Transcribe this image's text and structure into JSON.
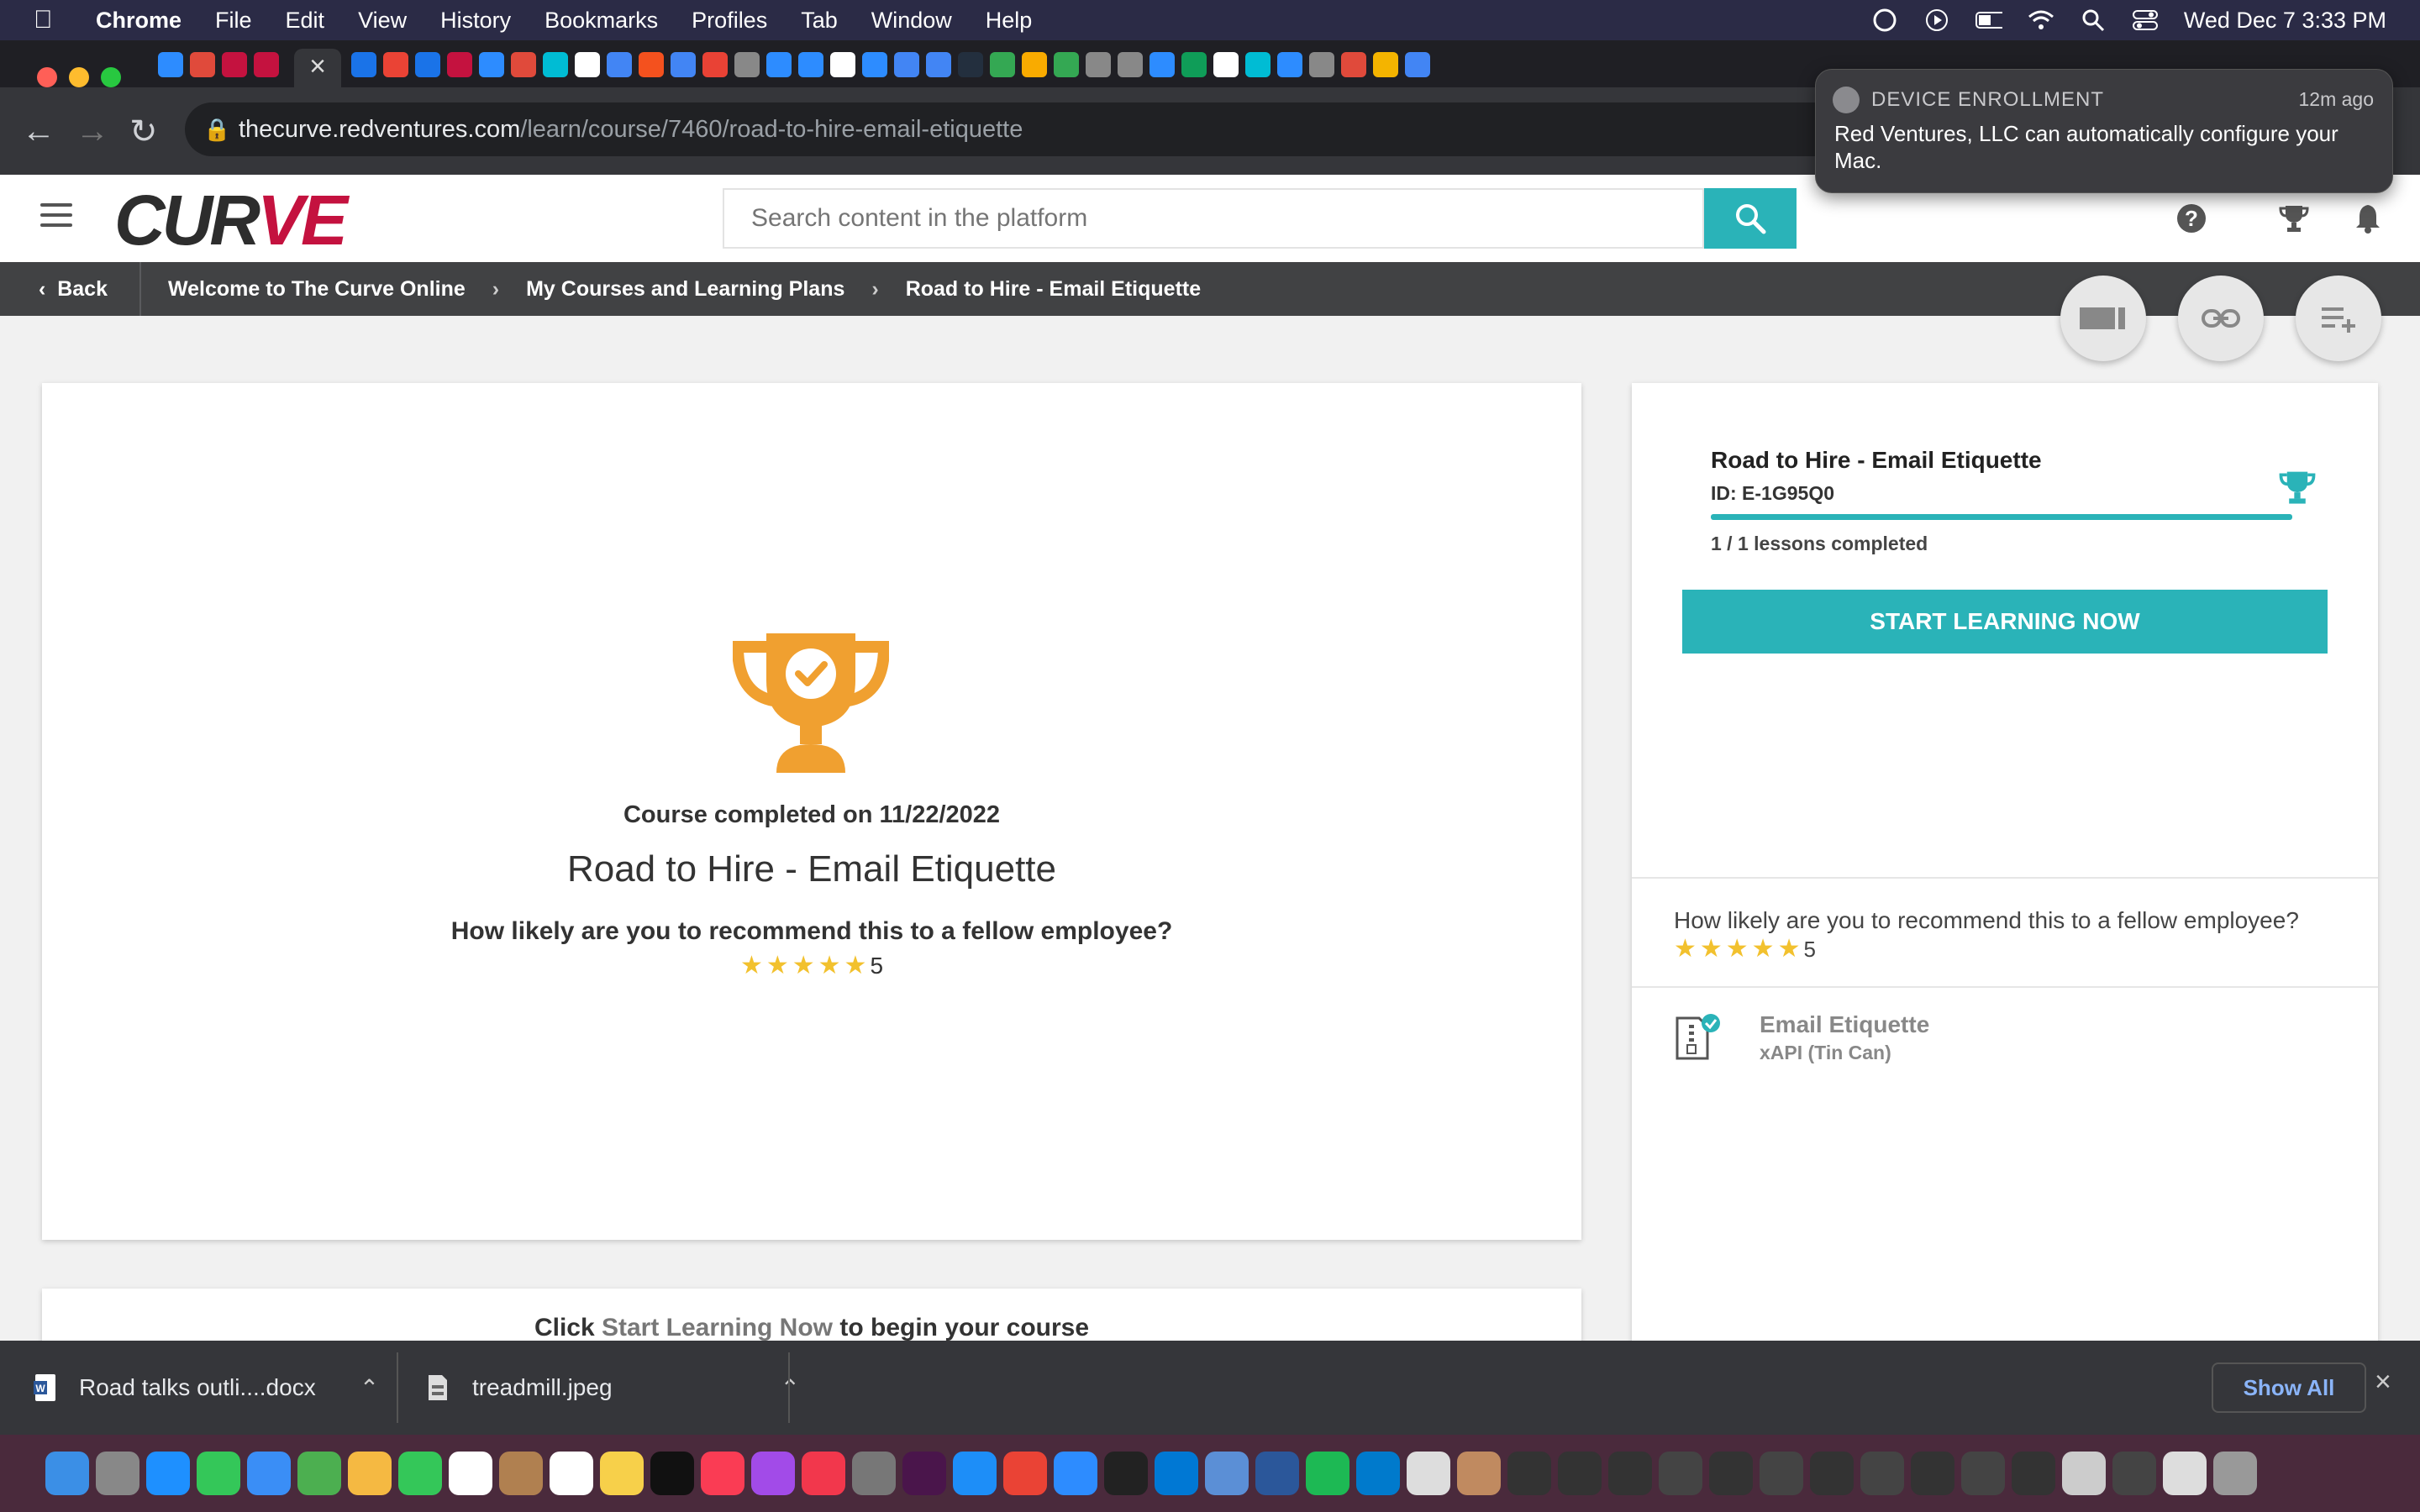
{
  "menubar": {
    "app": "Chrome",
    "items": [
      "File",
      "Edit",
      "View",
      "History",
      "Bookmarks",
      "Profiles",
      "Tab",
      "Window",
      "Help"
    ],
    "datetime": "Wed Dec 7  3:33 PM"
  },
  "browser": {
    "url_host": "thecurve.redventures.com",
    "url_path": "/learn/course/7460/road-to-hire-email-etiquette"
  },
  "notification": {
    "title": "DEVICE ENROLLMENT",
    "time": "12m ago",
    "body": "Red Ventures, LLC can automatically configure your Mac."
  },
  "header": {
    "logo_left": "CUR",
    "logo_right": "VE",
    "search_placeholder": "Search content in the platform"
  },
  "breadcrumb": {
    "back": "Back",
    "items": [
      "Welcome to The Curve Online",
      "My Courses and Learning Plans",
      "Road to Hire - Email Etiquette"
    ]
  },
  "main": {
    "completed_on": "Course completed on 11/22/2022",
    "title": "Road to Hire - Email Etiquette",
    "recommend_question": "How likely are you to recommend this to a fellow employee?",
    "rating": "5",
    "rating_stars": 5,
    "cta_prefix": "Click ",
    "cta_link": "Start Learning Now",
    "cta_suffix": " to begin your course"
  },
  "sidebar": {
    "title": "Road to Hire - Email Etiquette",
    "id": "ID: E-1G95Q0",
    "lessons_completed": "1 / 1 lessons completed",
    "progress": 1.0,
    "start_button": "START LEARNING NOW",
    "recommend_question": "How likely are you to recommend this to a fellow employee?",
    "rating": "5",
    "lesson": {
      "name": "Email Etiquette",
      "type": "xAPI (Tin Can)"
    }
  },
  "downloads": {
    "items": [
      {
        "name": "Road talks outli....docx"
      },
      {
        "name": "treadmill.jpeg"
      }
    ],
    "show_all": "Show All"
  },
  "colors": {
    "accent": "#2ab3b8",
    "trophy": "#f0a030",
    "star": "#f2c12e",
    "logo_red": "#c4123f"
  }
}
